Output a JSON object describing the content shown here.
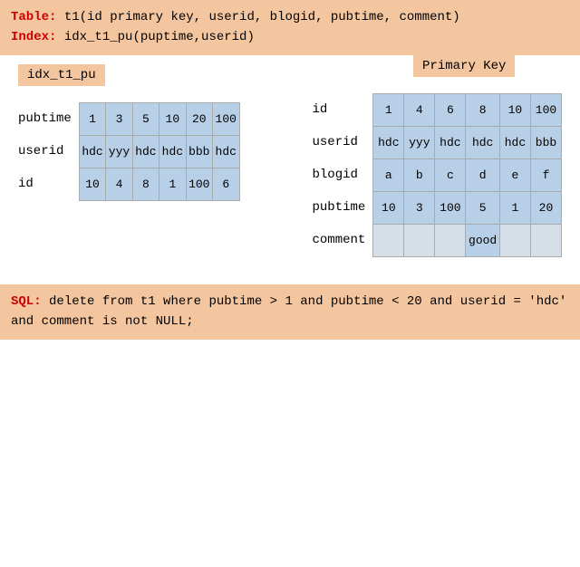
{
  "header": {
    "table_label": "Table:",
    "table_def": "t1(id primary key, userid, blogid, pubtime, comment)",
    "index_label": "Index:",
    "index_def": "idx_t1_pu(puptime,userid)"
  },
  "index_tag": "idx_t1_pu",
  "left_table": {
    "rows": [
      {
        "label": "pubtime",
        "cells": [
          "1",
          "3",
          "5",
          "10",
          "20",
          "100"
        ]
      },
      {
        "label": "userid",
        "cells": [
          "hdc",
          "yyy",
          "hdc",
          "hdc",
          "bbb",
          "hdc"
        ]
      },
      {
        "label": "id",
        "cells": [
          "10",
          "4",
          "8",
          "1",
          "100",
          "6"
        ]
      }
    ]
  },
  "pk_tag": "Primary Key",
  "pk_table": {
    "rows": [
      {
        "label": "id",
        "cells": [
          "1",
          "4",
          "6",
          "8",
          "10",
          "100"
        ]
      },
      {
        "label": "userid",
        "cells": [
          "hdc",
          "yyy",
          "hdc",
          "hdc",
          "hdc",
          "bbb"
        ]
      },
      {
        "label": "blogid",
        "cells": [
          "a",
          "b",
          "c",
          "d",
          "e",
          "f"
        ]
      },
      {
        "label": "pubtime",
        "cells": [
          "10",
          "3",
          "100",
          "5",
          "1",
          "20"
        ]
      },
      {
        "label": "comment",
        "cells": [
          "",
          "",
          "",
          "good",
          "",
          ""
        ]
      }
    ]
  },
  "sql": {
    "label": "SQL:",
    "text": "delete from t1 where pubtime > 1 and pubtime < 20 and userid =  'hdc' and comment is not NULL;"
  }
}
